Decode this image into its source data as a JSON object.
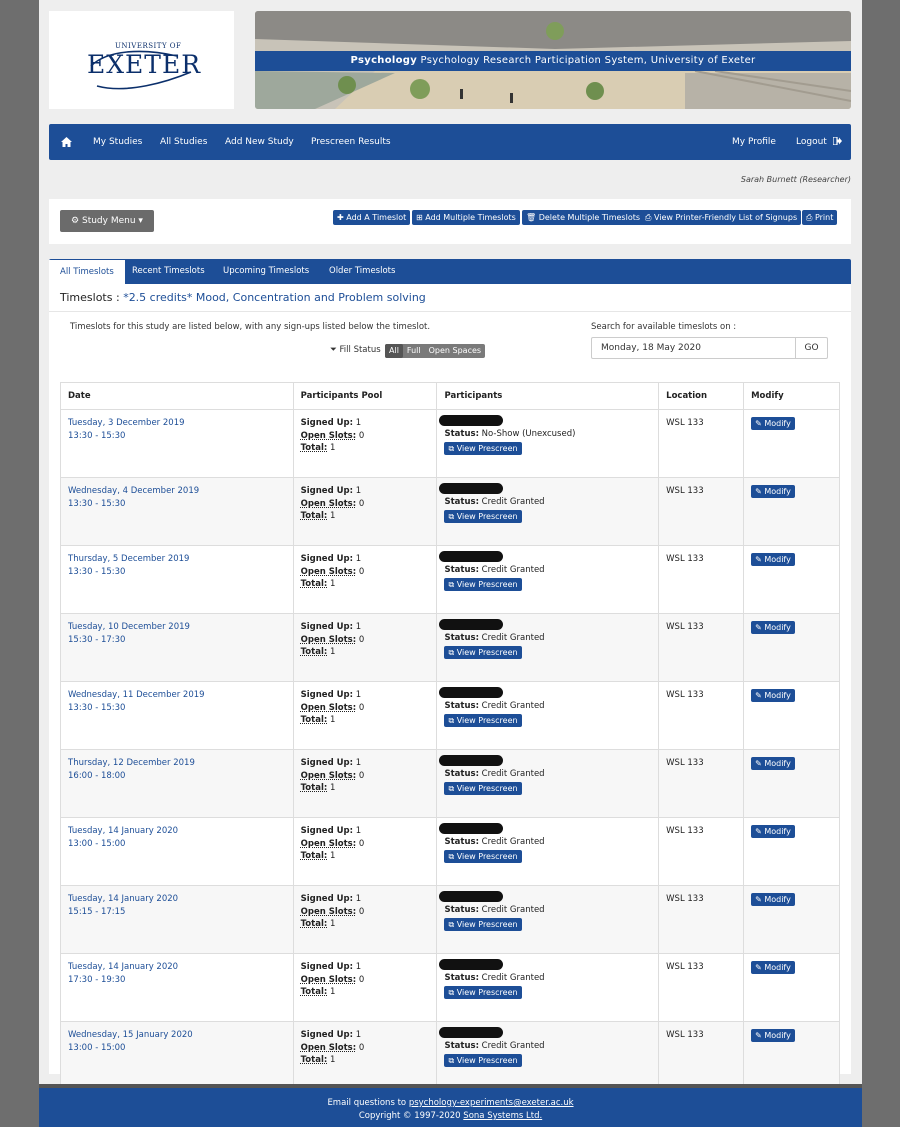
{
  "brand": {
    "logo_small": "UNIVERSITY OF",
    "logo_big": "EXETER",
    "banner_bold": "Psychology",
    "banner_text": "Psychology Research Participation System, University of Exeter"
  },
  "nav": {
    "home_icon": "home-icon",
    "items": [
      "My Studies",
      "All Studies",
      "Add New Study",
      "Prescreen Results"
    ],
    "my_profile": "My Profile",
    "logout": "Logout"
  },
  "user": {
    "name": "Sarah Burnett (Researcher)"
  },
  "toolbar": {
    "study_menu": "Study Menu",
    "add_timeslot": "Add A Timeslot",
    "add_multiple": "Add Multiple Timeslots",
    "delete_multiple": "Delete Multiple Timeslots",
    "printer_list": "View Printer-Friendly List of Signups",
    "print": "Print"
  },
  "tabs": [
    "All Timeslots",
    "Recent Timeslots",
    "Upcoming Timeslots",
    "Older Timeslots"
  ],
  "heading": {
    "prefix": "Timeslots : ",
    "study": "*2.5 credits* Mood, Concentration and Problem solving"
  },
  "intro": "Timeslots for this study are listed below, with any sign-ups listed below the timeslot.",
  "filter": {
    "label": "Fill Status",
    "options": [
      "All",
      "Full",
      "Open Spaces"
    ],
    "selected": "All"
  },
  "search": {
    "label": "Search for available timeslots on :",
    "value": "Monday, 18 May 2020",
    "go": "GO"
  },
  "table": {
    "headers": [
      "Date",
      "Participants Pool",
      "Participants",
      "Location",
      "Modify"
    ],
    "labels": {
      "signed_up": "Signed Up:",
      "open_slots": "Open Slots:",
      "total": "Total:",
      "status": "Status:",
      "view_prescreen": "View Prescreen",
      "modify": "Modify"
    },
    "rows": [
      {
        "date": "Tuesday, 3 December 2019",
        "time": "13:30 - 15:30",
        "signed": "1",
        "open": "0",
        "total": "1",
        "status": "No-Show (Unexcused)",
        "location": "WSL 133"
      },
      {
        "date": "Wednesday, 4 December 2019",
        "time": "13:30 - 15:30",
        "signed": "1",
        "open": "0",
        "total": "1",
        "status": "Credit Granted",
        "location": "WSL 133"
      },
      {
        "date": "Thursday, 5 December 2019",
        "time": "13:30 - 15:30",
        "signed": "1",
        "open": "0",
        "total": "1",
        "status": "Credit Granted",
        "location": "WSL 133"
      },
      {
        "date": "Tuesday, 10 December 2019",
        "time": "15:30 - 17:30",
        "signed": "1",
        "open": "0",
        "total": "1",
        "status": "Credit Granted",
        "location": "WSL 133"
      },
      {
        "date": "Wednesday, 11 December 2019",
        "time": "13:30 - 15:30",
        "signed": "1",
        "open": "0",
        "total": "1",
        "status": "Credit Granted",
        "location": "WSL 133"
      },
      {
        "date": "Thursday, 12 December 2019",
        "time": "16:00 - 18:00",
        "signed": "1",
        "open": "0",
        "total": "1",
        "status": "Credit Granted",
        "location": "WSL 133"
      },
      {
        "date": "Tuesday, 14 January 2020",
        "time": "13:00 - 15:00",
        "signed": "1",
        "open": "0",
        "total": "1",
        "status": "Credit Granted",
        "location": "WSL 133"
      },
      {
        "date": "Tuesday, 14 January 2020",
        "time": "15:15 - 17:15",
        "signed": "1",
        "open": "0",
        "total": "1",
        "status": "Credit Granted",
        "location": "WSL 133"
      },
      {
        "date": "Tuesday, 14 January 2020",
        "time": "17:30 - 19:30",
        "signed": "1",
        "open": "0",
        "total": "1",
        "status": "Credit Granted",
        "location": "WSL 133"
      },
      {
        "date": "Wednesday, 15 January 2020",
        "time": "13:00 - 15:00",
        "signed": "1",
        "open": "0",
        "total": "1",
        "status": "Credit Granted",
        "location": "WSL 133"
      }
    ]
  },
  "footer": {
    "email_prefix": "Email questions to ",
    "email": "psychology-experiments@exeter.ac.uk",
    "copyright_prefix": "Copyright © 1997-2020 ",
    "company": "Sona Systems Ltd."
  },
  "colors": {
    "primary": "#1d4e97",
    "page_bg": "#eeeeee",
    "outer_bg": "#6e6e6e"
  }
}
